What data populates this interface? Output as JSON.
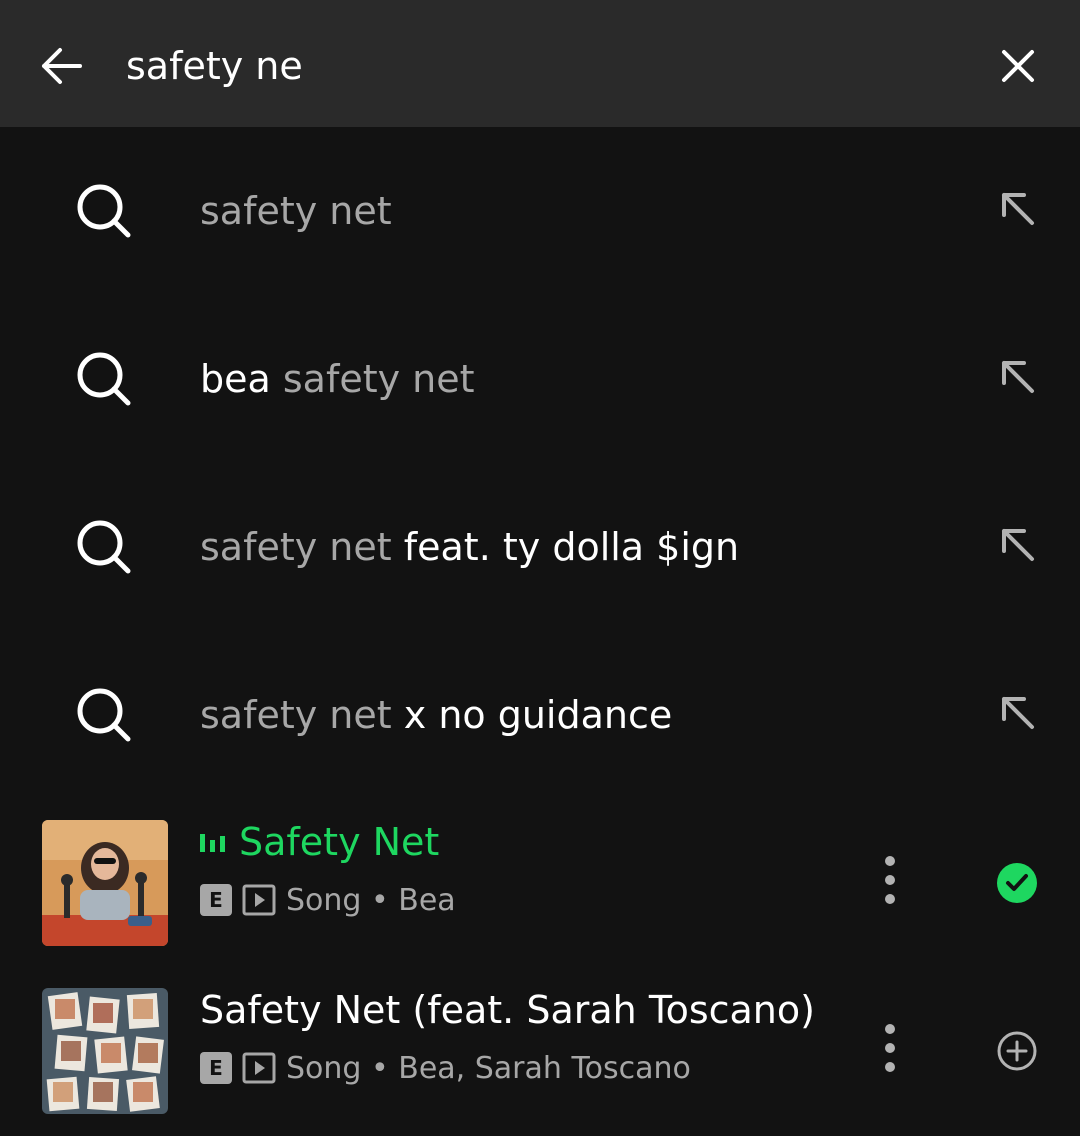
{
  "search": {
    "value": "safety ne",
    "back_icon": "arrow-left-icon",
    "clear_icon": "close-icon"
  },
  "suggestions": [
    {
      "prefix": "",
      "match": "safety net",
      "suffix": ""
    },
    {
      "prefix": "bea ",
      "match": "safety net",
      "suffix": ""
    },
    {
      "prefix": "",
      "match": "safety net",
      "suffix": " feat. ty dolla $ign"
    },
    {
      "prefix": "",
      "match": "safety net",
      "suffix": " x no guidance"
    }
  ],
  "results": [
    {
      "title": "Safety Net",
      "explicit_badge": "E",
      "type": "Song",
      "separator": " • ",
      "artists": "Bea",
      "playing": true,
      "in_library": true
    },
    {
      "title": "Safety Net (feat. Sarah Toscano)",
      "explicit_badge": "E",
      "type": "Song",
      "separator": " • ",
      "artists": "Bea, Sarah Toscano",
      "playing": false,
      "in_library": false
    }
  ],
  "colors": {
    "background": "#121212",
    "topbar": "#2a2a2a",
    "accent": "#1ed760",
    "muted": "#a7a7a7",
    "text": "#ffffff"
  }
}
